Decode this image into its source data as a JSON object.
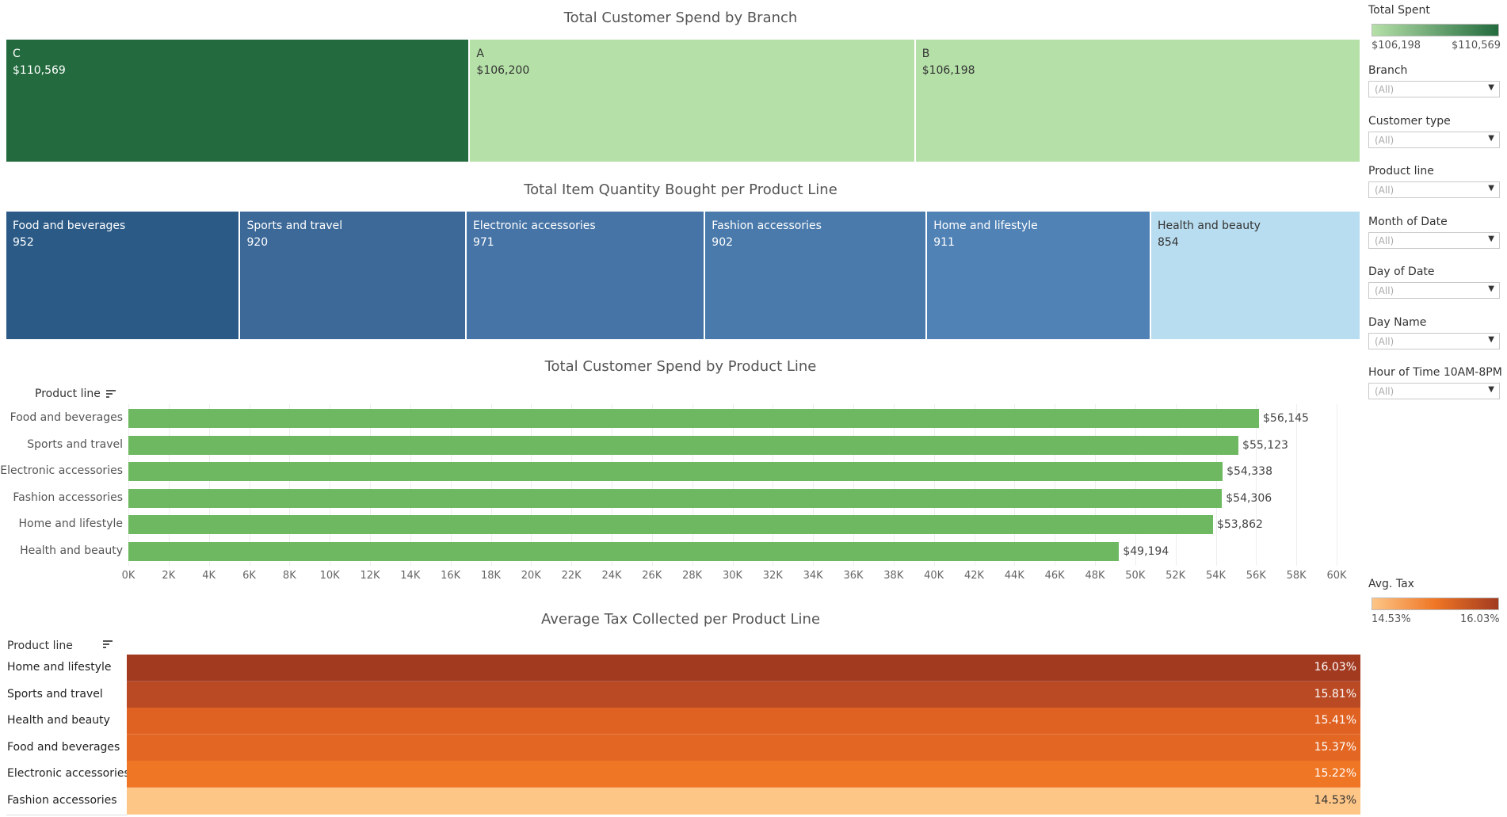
{
  "chart_data": [
    {
      "type": "treemap",
      "title": "Total Customer Spend by Branch",
      "categories": [
        "C",
        "A",
        "B"
      ],
      "values": [
        110569,
        106200,
        106198
      ],
      "value_labels": [
        "$110,569",
        "$106,200",
        "$106,198"
      ],
      "colors": [
        "#236b3e",
        "#b5e0a8",
        "#b5e0a8"
      ]
    },
    {
      "type": "treemap",
      "title": "Total Item Quantity Bought per Product Line",
      "categories": [
        "Food and beverages",
        "Sports and travel",
        "Electronic accessories",
        "Fashion accessories",
        "Home and lifestyle",
        "Health and beauty"
      ],
      "values": [
        952,
        920,
        971,
        902,
        911,
        854
      ],
      "value_labels": [
        "952",
        "920",
        "971",
        "902",
        "911",
        "854"
      ],
      "colors": [
        "#2b5a86",
        "#3c6998",
        "#4674a6",
        "#4a7aab",
        "#5182b5",
        "#b9ddf0"
      ]
    },
    {
      "type": "bar",
      "orientation": "horizontal",
      "title": "Total Customer Spend by Product Line",
      "ylabel": "Product line",
      "categories": [
        "Food and beverages",
        "Sports and travel",
        "Electronic accessories",
        "Fashion accessories",
        "Home and lifestyle",
        "Health and beauty"
      ],
      "values": [
        56145,
        55123,
        54338,
        54306,
        53862,
        49194
      ],
      "value_labels": [
        "$56,145",
        "$55,123",
        "$54,338",
        "$54,306",
        "$53,862",
        "$49,194"
      ],
      "xlim": [
        0,
        60000
      ],
      "xticks": [
        "0K",
        "2K",
        "4K",
        "6K",
        "8K",
        "10K",
        "12K",
        "14K",
        "16K",
        "18K",
        "20K",
        "22K",
        "24K",
        "26K",
        "28K",
        "30K",
        "32K",
        "34K",
        "36K",
        "38K",
        "40K",
        "42K",
        "44K",
        "46K",
        "48K",
        "50K",
        "52K",
        "54K",
        "56K",
        "58K",
        "60K"
      ],
      "bar_color": "#6fb862",
      "grid": true
    },
    {
      "type": "heatmap",
      "title": "Average Tax Collected per Product Line",
      "ylabel": "Product line",
      "categories": [
        "Home and lifestyle",
        "Sports and travel",
        "Health and beauty",
        "Food and beverages",
        "Electronic accessories",
        "Fashion accessories"
      ],
      "values": [
        16.03,
        15.81,
        15.41,
        15.37,
        15.22,
        14.53
      ],
      "value_labels": [
        "16.03%",
        "15.81%",
        "15.41%",
        "15.37%",
        "15.22%",
        "14.53%"
      ],
      "colors": [
        "#a23a20",
        "#b94a24",
        "#e06222",
        "#e36723",
        "#ef7625",
        "#fdc586"
      ]
    }
  ],
  "legend_total_spent": {
    "title": "Total Spent",
    "min_label": "$106,198",
    "max_label": "$110,569",
    "color_low": "#b5e0a8",
    "color_high": "#236b3e"
  },
  "legend_avg_tax": {
    "title": "Avg. Tax",
    "min_label": "14.53%",
    "max_label": "16.03%",
    "color_low": "#fdc586",
    "color_high": "#a23a20"
  },
  "filters": [
    {
      "label": "Branch",
      "value": "(All)"
    },
    {
      "label": "Customer type",
      "value": "(All)"
    },
    {
      "label": "Product line",
      "value": "(All)"
    },
    {
      "label": "Month of Date",
      "value": "(All)"
    },
    {
      "label": "Day of Date",
      "value": "(All)"
    },
    {
      "label": "Day Name",
      "value": "(All)"
    },
    {
      "label": "Hour of Time 10AM-8PM",
      "value": "(All)"
    }
  ],
  "icons": {
    "sort": "sort-descending-icon",
    "dropdown": "dropdown-arrow-icon"
  }
}
